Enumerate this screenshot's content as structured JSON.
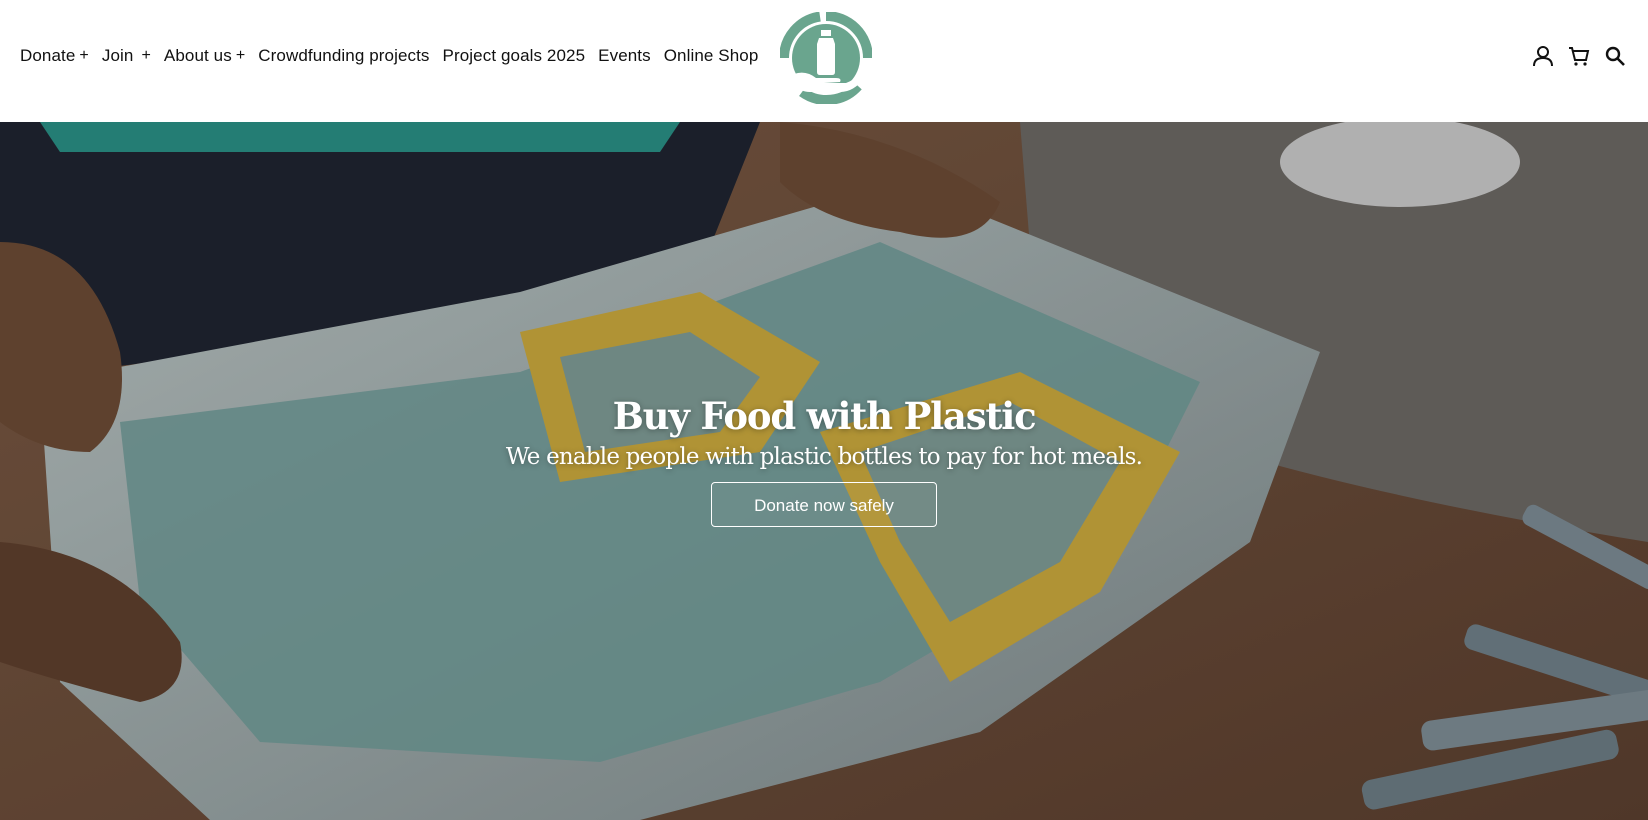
{
  "header": {
    "nav": [
      {
        "label": "Donate",
        "expand": "+"
      },
      {
        "label": "Join",
        "expand": "+"
      },
      {
        "label": "About us",
        "expand": "+"
      },
      {
        "label": "Crowdfunding projects"
      },
      {
        "label": "Project goals 2025"
      },
      {
        "label": "Events"
      },
      {
        "label": "Online Shop"
      }
    ],
    "logo_icon": "hand-with-bottle-recycle-logo",
    "logo_color": "#6aa58e",
    "icons": [
      "account-icon",
      "cart-icon",
      "search-icon"
    ]
  },
  "hero": {
    "title": "Buy Food with Plastic",
    "subtitle": "We enable people with plastic bottles to pay for hot meals.",
    "button_label": "Donate now safely",
    "background": "photo-of-hands-holding-brick-mold"
  }
}
